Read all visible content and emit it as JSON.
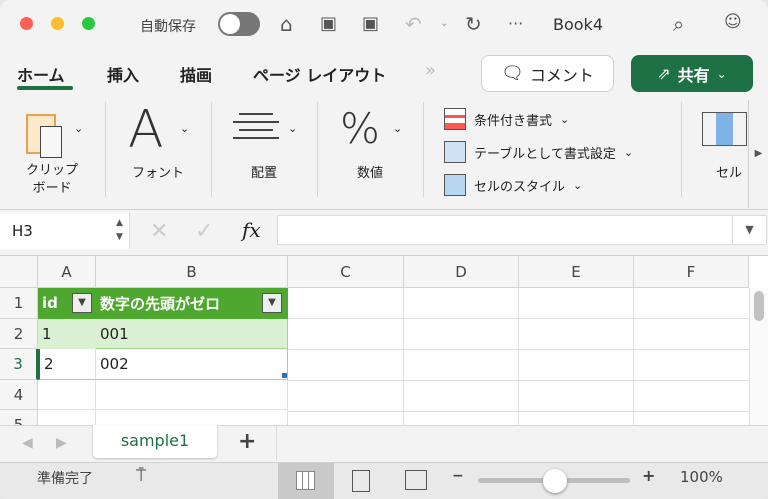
{
  "titlebar": {
    "autosave_label": "自動保存",
    "autosave_on": false,
    "doc_title": "Book4"
  },
  "tabs": [
    {
      "label": "ホーム",
      "active": true
    },
    {
      "label": "挿入"
    },
    {
      "label": "描画"
    },
    {
      "label": "ページ レイアウト"
    }
  ],
  "more_tabs": "»",
  "comment_label": "コメント",
  "share_label": "共有",
  "ribbon": {
    "clipboard_1": "クリップ",
    "clipboard_2": "ボード",
    "font": "フォント",
    "font_glyph": "A",
    "alignment": "配置",
    "number": "数値",
    "number_glyph": "%",
    "conditional_format": "条件付き書式",
    "format_as_table": "テーブルとして書式設定",
    "cell_styles": "セルのスタイル",
    "cells": "セル"
  },
  "formula_bar": {
    "name_box": "H3",
    "fx": "fx",
    "formula": ""
  },
  "columns": [
    "A",
    "B",
    "C",
    "D",
    "E",
    "F"
  ],
  "rows": [
    "1",
    "2",
    "3",
    "4",
    "5"
  ],
  "table": {
    "headers": [
      "id",
      "数字の先頭がゼロ"
    ],
    "data": [
      [
        "1",
        "001"
      ],
      [
        "2",
        "002"
      ]
    ]
  },
  "colors": {
    "accent": "#1e7145",
    "table_header": "#4ea72e",
    "band": "#d9f0d3"
  },
  "sheet_tabs": [
    {
      "label": "sample1",
      "active": true
    }
  ],
  "status": {
    "ready": "準備完了",
    "zoom": "100%",
    "zoom_value": 100
  }
}
